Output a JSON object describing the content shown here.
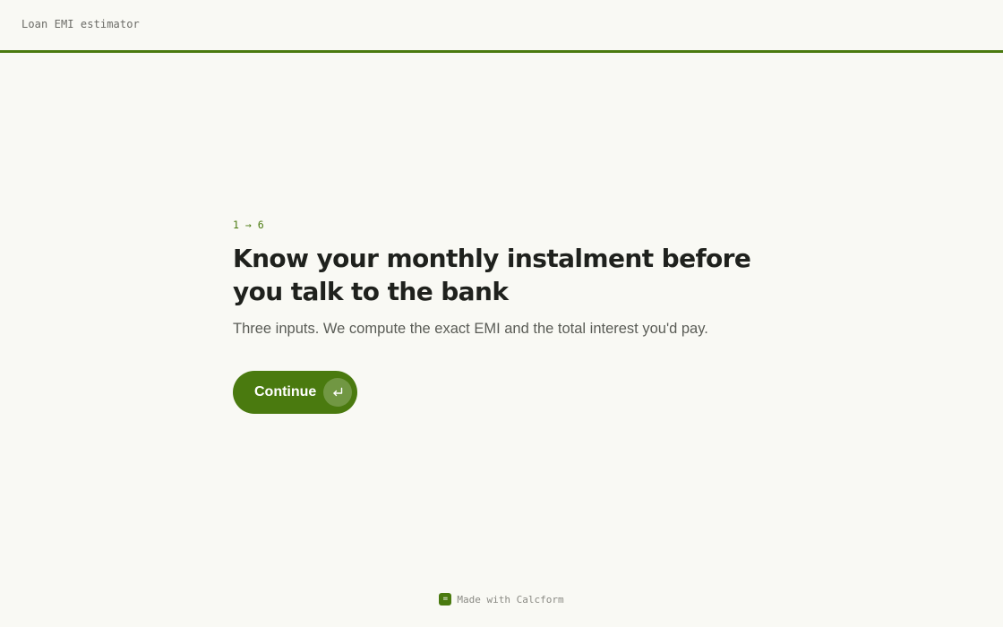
{
  "header": {
    "app_title": "Loan EMI estimator"
  },
  "hero": {
    "step_indicator": "1 → 6",
    "headline": "Know your monthly instalment before you talk to the bank",
    "subtitle": "Three inputs. We compute the exact EMI and the total interest you'd pay."
  },
  "actions": {
    "continue_label": "Continue",
    "continue_icon": "enter-return-icon"
  },
  "footer": {
    "logo_glyph": "=",
    "made_with": "Made with Calcform"
  },
  "colors": {
    "accent": "#4a7a0f",
    "background": "#f9f9f4",
    "text": "#1f211d",
    "muted": "#5a5c56"
  }
}
